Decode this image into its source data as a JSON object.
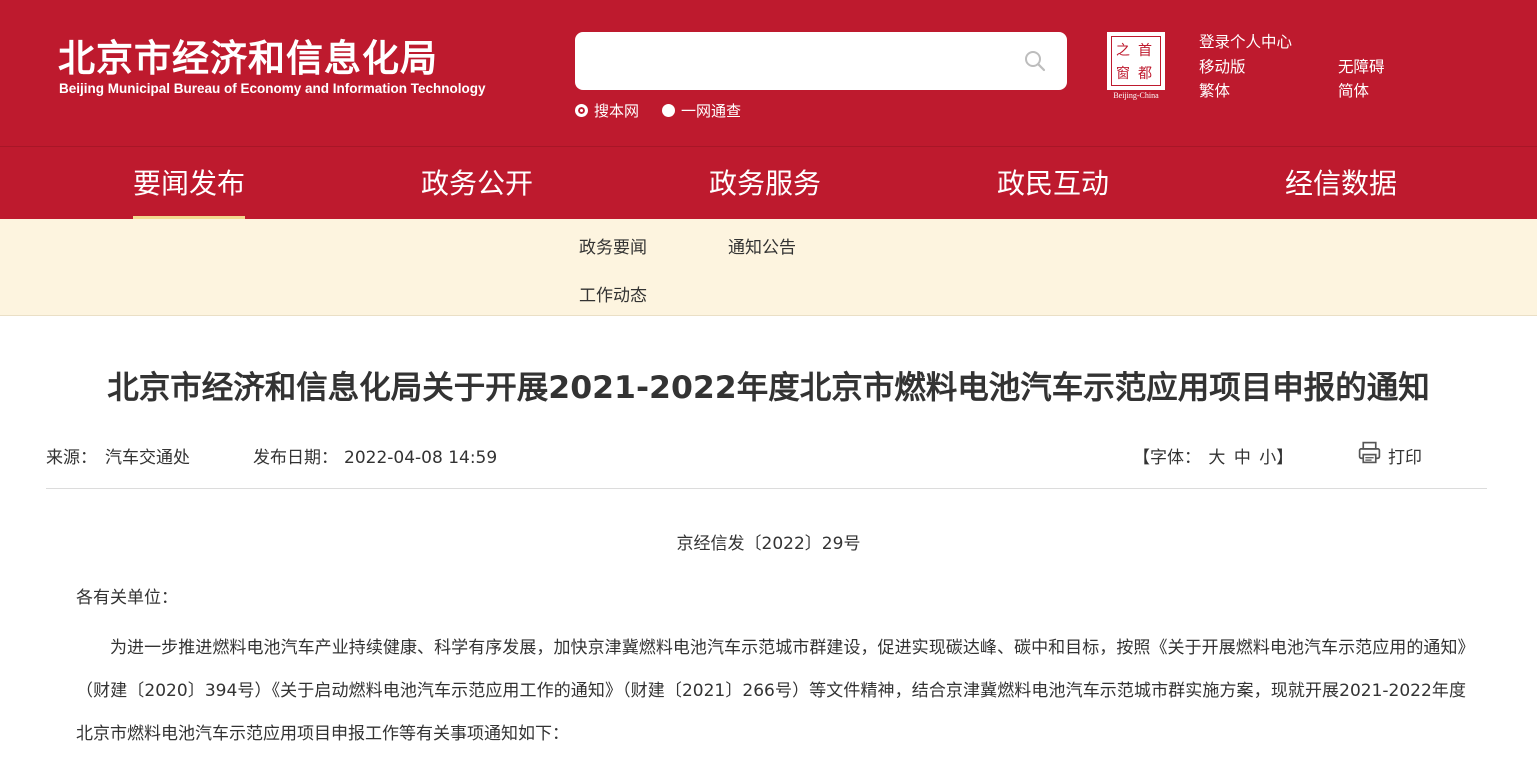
{
  "header": {
    "logo_cn": "北京市经济和信息化局",
    "logo_en": "Beijing Municipal Bureau of Economy and Information Technology",
    "search": {
      "placeholder": "",
      "scopes": [
        "搜本网",
        "一网通查"
      ]
    },
    "emblem": {
      "chars": [
        "首",
        "都",
        "之",
        "窗"
      ],
      "caption": "Beijing-China"
    },
    "links": {
      "login": "登录个人中心",
      "mobile": "移动版",
      "accessible": "无障碍",
      "traditional": "繁体",
      "simplified": "简体"
    }
  },
  "nav": {
    "items": [
      "要闻发布",
      "政务公开",
      "政务服务",
      "政民互动",
      "经信数据"
    ],
    "active": "要闻发布"
  },
  "subnav": {
    "items": [
      "政务要闻",
      "通知公告",
      "工作动态"
    ]
  },
  "article": {
    "title": "北京市经济和信息化局关于开展2021-2022年度北京市燃料电池汽车示范应用项目申报的通知",
    "meta": {
      "source_label": "来源：",
      "source": "汽车交通处",
      "date_label": "发布日期：",
      "date": "2022-04-08 14:59",
      "font_label": "【字体：",
      "font_large": "大",
      "font_medium": "中",
      "font_small": "小",
      "font_end": "】",
      "print": "打印"
    },
    "doc_no": "京经信发〔2022〕29号",
    "greeting": "各有关单位：",
    "paragraph": "为进一步推进燃料电池汽车产业持续健康、科学有序发展，加快京津冀燃料电池汽车示范城市群建设，促进实现碳达峰、碳中和目标，按照《关于开展燃料电池汽车示范应用的通知》（财建〔2020〕394号）《关于启动燃料电池汽车示范应用工作的通知》（财建〔2021〕266号）等文件精神，结合京津冀燃料电池汽车示范城市群实施方案，现就开展2021-2022年度北京市燃料电池汽车示范应用项目申报工作等有关事项通知如下："
  },
  "colors": {
    "brand_red": "#be1a2e",
    "subnav_bg": "#fdf4df",
    "active_underline": "#f3d98f",
    "text": "#333333"
  },
  "icons": [
    "search-icon",
    "print-icon"
  ]
}
